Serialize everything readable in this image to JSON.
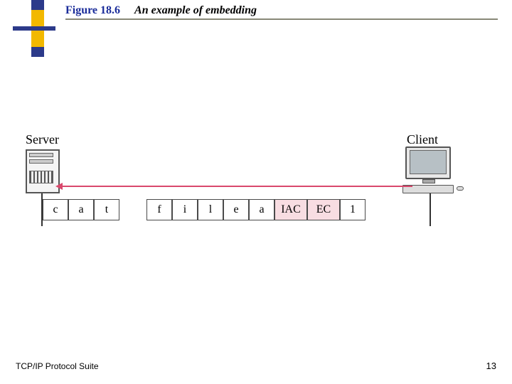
{
  "title": {
    "figure_number": "Figure 18.6",
    "caption": "An example of embedding"
  },
  "diagram": {
    "server_label": "Server",
    "client_label": "Client",
    "bytes": [
      "c",
      "a",
      "t",
      "f",
      "i",
      "l",
      "e",
      "a",
      "IAC",
      "EC",
      "1"
    ]
  },
  "footer": {
    "suite": "TCP/IP Protocol Suite",
    "page_number": "13"
  }
}
